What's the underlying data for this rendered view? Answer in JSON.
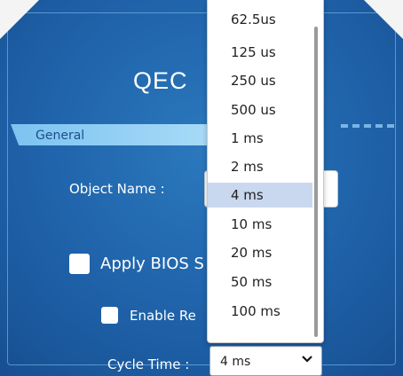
{
  "dialog": {
    "title": "QEC"
  },
  "section": {
    "label": "General"
  },
  "fields": {
    "object_name_label": "Object Name :",
    "apply_bios_label": "Apply BIOS S",
    "enable_label": "Enable Re",
    "cycle_time_label": "Cycle Time :",
    "cycle_time_value": "4 ms"
  },
  "dropdown": {
    "options": [
      "62.5us",
      "125 us",
      "250 us",
      "500 us",
      "1 ms",
      "2 ms",
      "4 ms",
      "10 ms",
      "20 ms",
      "50 ms",
      "100 ms"
    ],
    "selected": "4 ms"
  },
  "icons": {
    "select_chevron": "chevron-down-icon"
  },
  "colors": {
    "panel": "#1f62a9",
    "section_bar": "#8fcdf4",
    "highlight": "#c9d8ee"
  }
}
